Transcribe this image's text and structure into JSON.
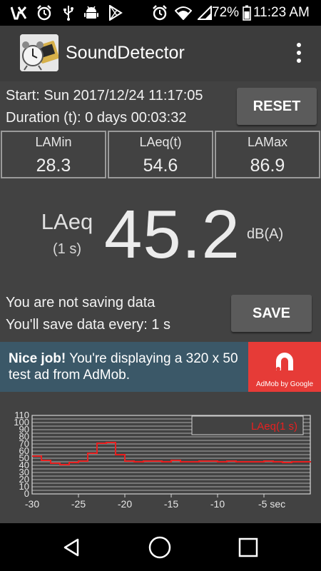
{
  "status_bar": {
    "battery_percent": "72%",
    "time": "11:23 AM",
    "left_icons": [
      "vpn-key-icon",
      "alarm-icon",
      "usb-icon",
      "android-icon",
      "play-store-icon"
    ],
    "right_icons": [
      "alarm-icon",
      "wifi-icon",
      "signal-icon",
      "battery-icon"
    ]
  },
  "app_bar": {
    "title": "SoundDetector",
    "logo_icon": "app-logo-icon",
    "menu_icon": "overflow-menu-icon"
  },
  "session": {
    "start": "Start: Sun 2017/12/24 11:17:05",
    "duration": "Duration (t): 0 days 00:03:32",
    "reset_label": "RESET"
  },
  "stats": [
    {
      "label": "LAMin",
      "value": "28.3"
    },
    {
      "label": "LAeq(t)",
      "value": "54.6"
    },
    {
      "label": "LAMax",
      "value": "86.9"
    }
  ],
  "current": {
    "label": "LAeq",
    "interval": "(1 s)",
    "value": "45.2",
    "unit": "dB(A)"
  },
  "saving": {
    "status": "You are not saving data",
    "interval": "You'll save data every: 1 s",
    "save_label": "SAVE"
  },
  "ad": {
    "headline": "Nice job!",
    "body": " You're displaying a 320 x 50 test ad from AdMob.",
    "brand": "AdMob by Google"
  },
  "colors": {
    "accent_line": "#e82020",
    "panel": "#424242",
    "ad_background": "#3b5868",
    "ad_logo_background": "#e63b37"
  },
  "chart_data": {
    "type": "line",
    "series": [
      {
        "name": "LAeq(1 s)",
        "x": [
          -30,
          -29,
          -28,
          -27,
          -26,
          -25,
          -24,
          -23,
          -22,
          -21,
          -20,
          -19,
          -18,
          -17,
          -16,
          -15,
          -14,
          -13,
          -12,
          -11,
          -10,
          -9,
          -8,
          -7,
          -6,
          -5,
          -4,
          -3,
          -2,
          -1,
          0
        ],
        "y": [
          53,
          47,
          43,
          41,
          44,
          46,
          57,
          71,
          72,
          55,
          46,
          45,
          46,
          46,
          45,
          47,
          45,
          45,
          46,
          46,
          45,
          46,
          45,
          45,
          45,
          46,
          45,
          44,
          45,
          45,
          44
        ]
      }
    ],
    "xlim": [
      -30,
      0
    ],
    "ylim": [
      0,
      110
    ],
    "x_ticks": [
      "-30",
      "-25",
      "-20",
      "-15",
      "-10",
      "-5 sec"
    ],
    "y_ticks": [
      "0",
      "10",
      "20",
      "30",
      "40",
      "50",
      "60",
      "70",
      "80",
      "90",
      "100",
      "110"
    ],
    "grid": true,
    "legend": "top-right",
    "line_color": "#e82020"
  },
  "nav_bar": {
    "icons": [
      "back-icon",
      "home-icon",
      "recents-icon"
    ]
  }
}
